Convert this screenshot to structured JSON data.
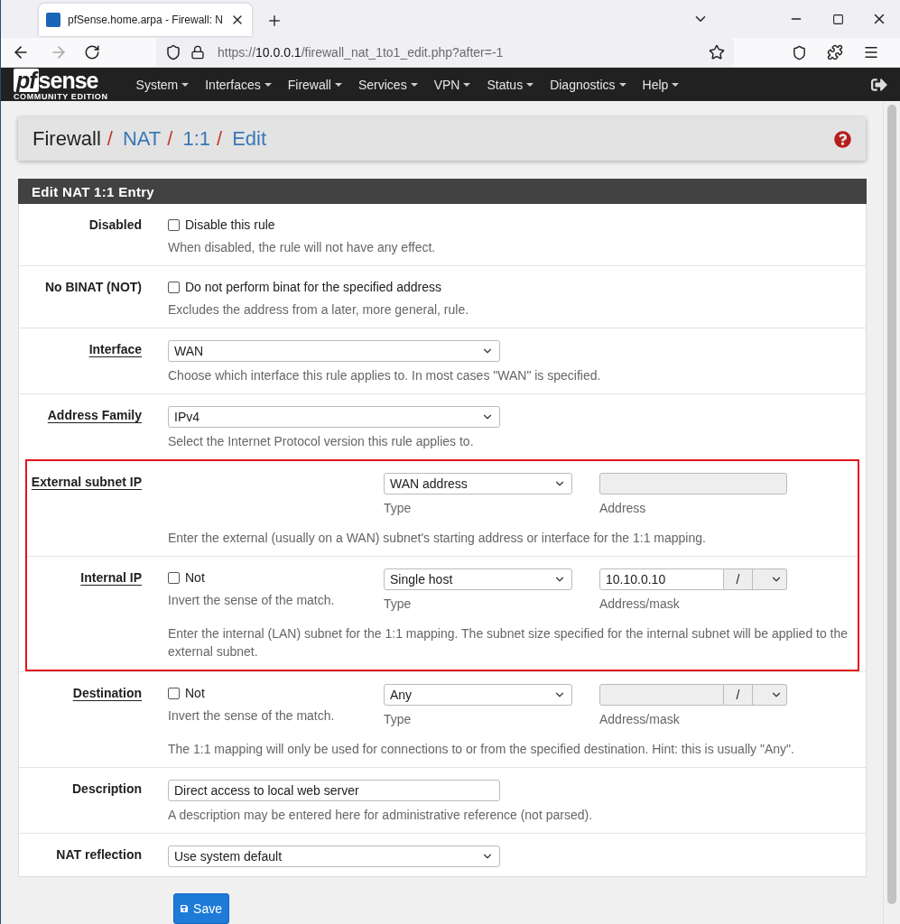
{
  "browser": {
    "tab_title": "pfSense.home.arpa - Firewall: N",
    "url": {
      "scheme": "https://",
      "host": "10.0.0.1",
      "path": "/firewall_nat_1to1_edit.php?after=-1"
    }
  },
  "logo": {
    "mark": "pf",
    "word": "sense",
    "edition": "COMMUNITY EDITION"
  },
  "menu": [
    "System",
    "Interfaces",
    "Firewall",
    "Services",
    "VPN",
    "Status",
    "Diagnostics",
    "Help"
  ],
  "breadcrumb": {
    "separator": "/",
    "items": [
      {
        "text": "Firewall",
        "link": false
      },
      {
        "text": "NAT",
        "link": true
      },
      {
        "text": "1:1",
        "link": true
      },
      {
        "text": "Edit",
        "link": true
      }
    ]
  },
  "panel": {
    "title": "Edit NAT 1:1 Entry"
  },
  "rows": [
    {
      "kind": "checkbox",
      "label": "Disabled",
      "underlined": false,
      "highlighted": false,
      "checkbox": {
        "label": "Disable this rule",
        "checked": false
      },
      "help": "When disabled, the rule will not have any effect."
    },
    {
      "kind": "checkbox",
      "label": "No BINAT (NOT)",
      "underlined": false,
      "highlighted": false,
      "checkbox": {
        "label": "Do not perform binat for the specified address",
        "checked": false
      },
      "help": "Excludes the address from a later, more general, rule."
    },
    {
      "kind": "select",
      "label": "Interface",
      "underlined": true,
      "highlighted": false,
      "value": "WAN",
      "help": "Choose which interface this rule applies to. In most cases \"WAN\" is specified."
    },
    {
      "kind": "select",
      "label": "Address Family",
      "underlined": true,
      "highlighted": false,
      "value": "IPv4",
      "help": "Select the Internet Protocol version this rule applies to."
    },
    {
      "kind": "address",
      "label": "External subnet IP",
      "underlined": true,
      "highlighted": true,
      "type": {
        "value": "WAN address",
        "caption": "Type"
      },
      "address": {
        "disabled": true,
        "caption": "Address"
      },
      "help": "Enter the external (usually on a WAN) subnet's starting address or interface for the 1:1 mapping."
    },
    {
      "kind": "address",
      "label": "Internal IP",
      "underlined": true,
      "highlighted": true,
      "not": {
        "label": "Not",
        "checked": false,
        "caption": "Invert the sense of the match."
      },
      "type": {
        "value": "Single host",
        "caption": "Type"
      },
      "address": {
        "value": "10.10.0.10",
        "disabled": false,
        "caption": "Address/mask",
        "separator": "/"
      },
      "help": "Enter the internal (LAN) subnet for the 1:1 mapping. The subnet size specified for the internal subnet will be applied to the external subnet."
    },
    {
      "kind": "address",
      "label": "Destination",
      "underlined": true,
      "highlighted": false,
      "not": {
        "label": "Not",
        "checked": false,
        "caption": "Invert the sense of the match."
      },
      "type": {
        "value": "Any",
        "caption": "Type"
      },
      "address": {
        "disabled": true,
        "caption": "Address/mask",
        "separator": "/"
      },
      "help": "The 1:1 mapping will only be used for connections to or from the specified destination. Hint: this is usually \"Any\"."
    },
    {
      "kind": "text",
      "label": "Description",
      "underlined": false,
      "highlighted": false,
      "value": "Direct access to local web server",
      "help": "A description may be entered here for administrative reference (not parsed)."
    },
    {
      "kind": "select",
      "label": "NAT reflection",
      "underlined": false,
      "highlighted": false,
      "value": "Use system default"
    }
  ],
  "save_button": "Save"
}
